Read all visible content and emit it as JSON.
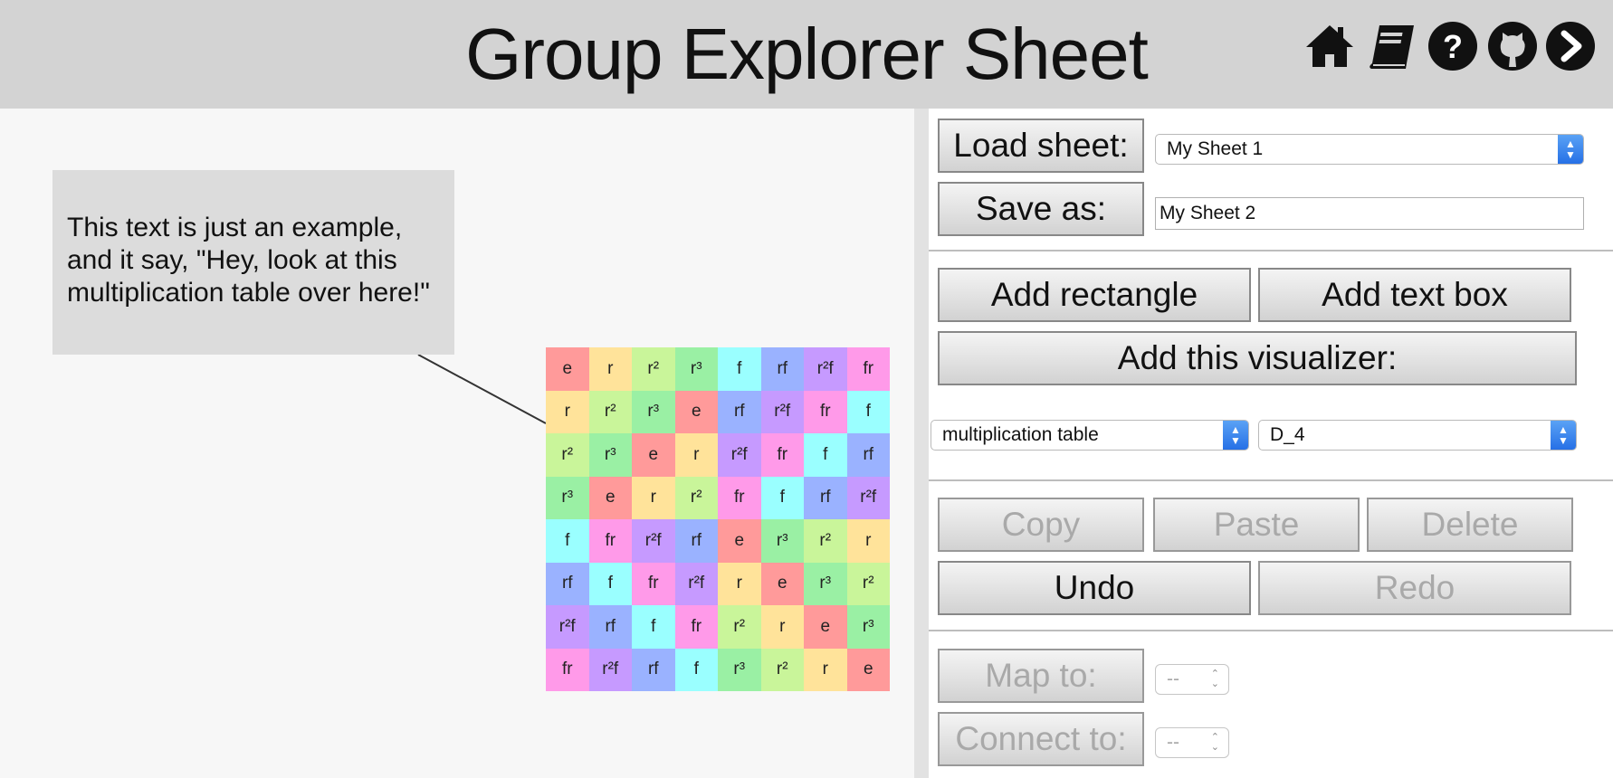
{
  "header": {
    "title": "Group Explorer Sheet",
    "icons": [
      "home-icon",
      "book-icon",
      "help-icon",
      "github-icon",
      "next-icon"
    ]
  },
  "canvas": {
    "textbox_text": "This text is just an example, and it say, \"Hey, look at this multiplication table over here!\"",
    "table": {
      "labels": [
        [
          "e",
          "r",
          "r²",
          "r³",
          "f",
          "rf",
          "r²f",
          "fr"
        ],
        [
          "r",
          "r²",
          "r³",
          "e",
          "rf",
          "r²f",
          "fr",
          "f"
        ],
        [
          "r²",
          "r³",
          "e",
          "r",
          "r²f",
          "fr",
          "f",
          "rf"
        ],
        [
          "r³",
          "e",
          "r",
          "r²",
          "fr",
          "f",
          "rf",
          "r²f"
        ],
        [
          "f",
          "fr",
          "r²f",
          "rf",
          "e",
          "r³",
          "r²",
          "r"
        ],
        [
          "rf",
          "f",
          "fr",
          "r²f",
          "r",
          "e",
          "r³",
          "r²"
        ],
        [
          "r²f",
          "rf",
          "f",
          "fr",
          "r²",
          "r",
          "e",
          "r³"
        ],
        [
          "fr",
          "r²f",
          "rf",
          "f",
          "r³",
          "r²",
          "r",
          "e"
        ]
      ],
      "colors": {
        "e": "#ff9a9a",
        "r": "#ffe39a",
        "r²": "#c9f59a",
        "r³": "#9af0a4",
        "f": "#9affff",
        "rf": "#9ab2ff",
        "r²f": "#c69aff",
        "fr": "#ff9ae9"
      }
    }
  },
  "panel": {
    "load_label": "Load sheet:",
    "load_selected": "My Sheet 1",
    "save_label": "Save as:",
    "save_value": "My Sheet 2",
    "add_rectangle": "Add rectangle",
    "add_textbox": "Add text box",
    "add_visualizer": "Add this visualizer:",
    "visualizer_type": "multiplication table",
    "group": "D_4",
    "copy": "Copy",
    "paste": "Paste",
    "delete": "Delete",
    "undo": "Undo",
    "redo": "Redo",
    "map_to": "Map to:",
    "map_to_value": "--",
    "connect_to": "Connect to:",
    "connect_to_value": "--"
  }
}
